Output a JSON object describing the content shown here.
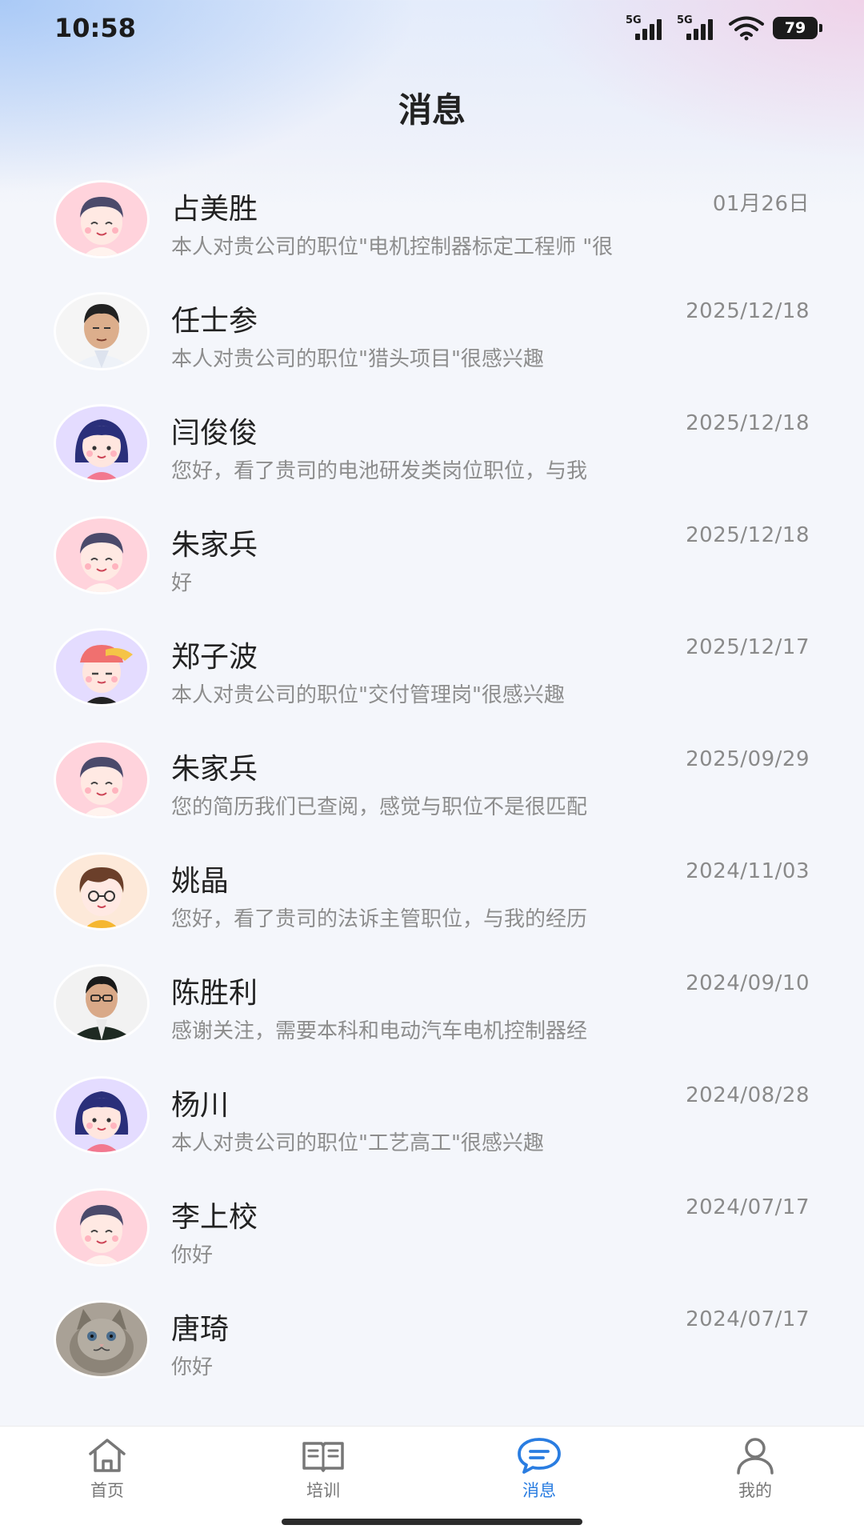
{
  "status_bar": {
    "time": "10:58",
    "signal1_label": "5G",
    "signal2_label": "5G",
    "battery": "79"
  },
  "page": {
    "title": "消息"
  },
  "conversations": [
    {
      "name": "占美胜",
      "date": "01月26日",
      "preview": "本人对贵公司的职位\"电机控制器标定工程师 \"很",
      "avatar": "boy-pink"
    },
    {
      "name": "任士参",
      "date": "2025/12/18",
      "preview": "本人对贵公司的职位\"猎头项目\"很感兴趣",
      "avatar": "photo-man-shirt"
    },
    {
      "name": "闫俊俊",
      "date": "2025/12/18",
      "preview": "您好，看了贵司的电池研发类岗位职位，与我",
      "avatar": "girl-purple"
    },
    {
      "name": "朱家兵",
      "date": "2025/12/18",
      "preview": "好",
      "avatar": "boy-pink"
    },
    {
      "name": "郑子波",
      "date": "2025/12/17",
      "preview": "本人对贵公司的职位\"交付管理岗\"很感兴趣",
      "avatar": "boy-cap"
    },
    {
      "name": "朱家兵",
      "date": "2025/09/29",
      "preview": "您的简历我们已查阅，感觉与职位不是很匹配",
      "avatar": "boy-pink"
    },
    {
      "name": "姚晶",
      "date": "2024/11/03",
      "preview": "您好，看了贵司的法诉主管职位，与我的经历",
      "avatar": "boy-yellow"
    },
    {
      "name": "陈胜利",
      "date": "2024/09/10",
      "preview": "感谢关注，需要本科和电动汽车电机控制器经",
      "avatar": "photo-man-suit"
    },
    {
      "name": "杨川",
      "date": "2024/08/28",
      "preview": "本人对贵公司的职位\"工艺高工\"很感兴趣",
      "avatar": "girl-purple"
    },
    {
      "name": "李上校",
      "date": "2024/07/17",
      "preview": "你好",
      "avatar": "boy-pink"
    },
    {
      "name": "唐琦",
      "date": "2024/07/17",
      "preview": "你好",
      "avatar": "photo-cat"
    }
  ],
  "tabs": [
    {
      "label": "首页",
      "icon": "home-icon",
      "active": false
    },
    {
      "label": "培训",
      "icon": "book-icon",
      "active": false
    },
    {
      "label": "消息",
      "icon": "chat-bubble-icon",
      "active": true
    },
    {
      "label": "我的",
      "icon": "person-icon",
      "active": false
    }
  ],
  "colors": {
    "accent": "#2a7de1",
    "text": "#222222",
    "muted": "#8d8d8d"
  }
}
